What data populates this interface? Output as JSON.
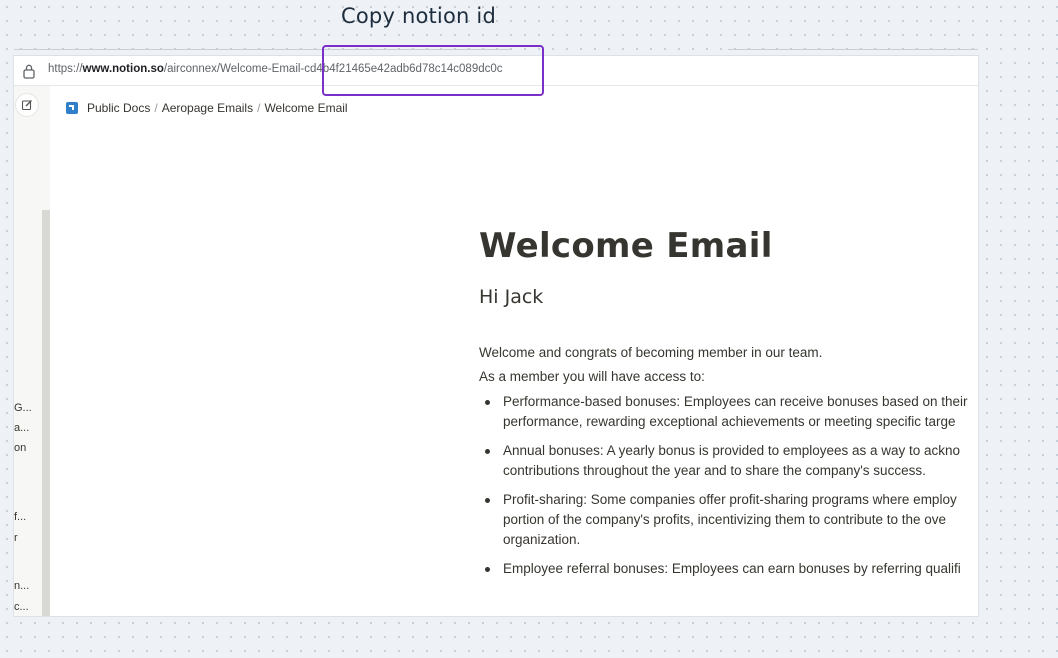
{
  "annotation": {
    "caption": "Copy notion id"
  },
  "browser": {
    "url_prefix": "https://",
    "url_domain": "www.notion.so",
    "url_path": "/airconnex/Welcome-Email-",
    "url_id": "cd4b4f21465e42adb6d78c14c089dc0c",
    "lock_icon": "lock-icon"
  },
  "breadcrumb": {
    "icon": "notion-page-icon",
    "items": [
      "Public Docs",
      "Aeropage Emails",
      "Welcome Email"
    ],
    "separator": "/"
  },
  "sidebar": {
    "toggle_icon": "edit-icon",
    "items": [
      "G...",
      "a...",
      "on",
      "f...",
      "r",
      "n...",
      "c..."
    ]
  },
  "page": {
    "title": "Welcome Email",
    "greeting": "Hi Jack",
    "intro": "Welcome and congrats of becoming member in our team.",
    "access": "As a member you will have access to:",
    "bullets": [
      {
        "line1": "Performance-based bonuses: Employees can receive bonuses based on their",
        "line2": "performance, rewarding exceptional achievements or meeting specific targe",
        "line3": ""
      },
      {
        "line1": "Annual bonuses: A yearly bonus is provided to employees as a way to ackno",
        "line2": "contributions throughout the year and to share the company's success.",
        "line3": ""
      },
      {
        "line1": "Profit-sharing: Some companies offer profit-sharing programs where employ",
        "line2": "portion of the company's profits, incentivizing them to contribute to the ove",
        "line3": "organization."
      },
      {
        "line1": "Employee referral bonuses: Employees can earn bonuses by referring qualifi",
        "line2": "",
        "line3": ""
      }
    ]
  },
  "colors": {
    "highlight_box": "#7b2fc9",
    "text": "#37352f",
    "sidebar_bg": "#f7f7f5"
  }
}
